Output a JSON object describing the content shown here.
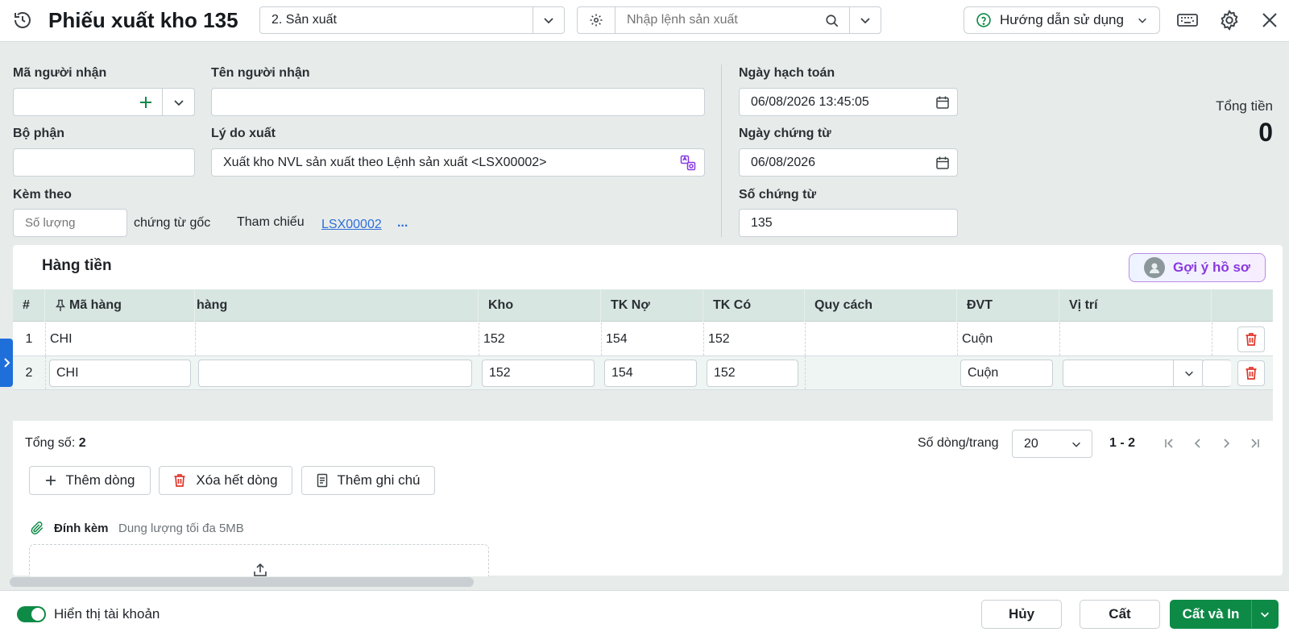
{
  "header": {
    "title": "Phiếu xuất kho 135",
    "type_select_value": "2. Sản xuất",
    "search_placeholder": "Nhập lệnh sản xuất",
    "help_label": "Hướng dẫn sử dụng"
  },
  "form": {
    "ma_nguoi_nhan_label": "Mã người nhận",
    "ten_nguoi_nhan_label": "Tên người nhận",
    "bo_phan_label": "Bộ phận",
    "ly_do_xuat_label": "Lý do xuất",
    "ly_do_xuat_value": "Xuất kho NVL sản xuất theo Lệnh sản xuất <LSX00002>",
    "kem_theo_label": "Kèm theo",
    "so_luong_placeholder": "Số lượng",
    "chung_tu_goc_label": "chứng từ gốc",
    "tham_chieu_label": "Tham chiếu",
    "tham_chieu_link": "LSX00002",
    "tham_chieu_more": "...",
    "ngay_hach_toan_label": "Ngày hạch toán",
    "ngay_hach_toan_value": "06/08/2026 13:45:05",
    "ngay_chung_tu_label": "Ngày chứng từ",
    "ngay_chung_tu_value": "06/08/2026",
    "so_chung_tu_label": "Số chứng từ",
    "so_chung_tu_value": "135",
    "tong_tien_label": "Tổng tiền",
    "tong_tien_value": "0"
  },
  "grid": {
    "section_title": "Hàng tiền",
    "suggest_label": "Gợi ý hồ sơ",
    "columns": [
      "#",
      "Mã hàng",
      "hàng",
      "Kho",
      "TK Nợ",
      "TK Có",
      "Quy cách",
      "ĐVT",
      "Vị trí"
    ],
    "rows": [
      {
        "num": "1",
        "ma_hang": "CHI",
        "ten_hang": "",
        "kho": "152",
        "tk_no": "154",
        "tk_co": "152",
        "quy_cach": "",
        "dvt": "Cuộn",
        "vi_tri": ""
      },
      {
        "num": "2",
        "ma_hang": "CHI",
        "ten_hang": "",
        "kho": "152",
        "tk_no": "154",
        "tk_co": "152",
        "quy_cach": "",
        "dvt": "Cuộn",
        "vi_tri": ""
      }
    ],
    "total_label": "Tổng số:",
    "total_value": "2",
    "page_size_label": "Số dòng/trang",
    "page_size_value": "20",
    "page_range": "1 - 2"
  },
  "actions": {
    "add_row": "Thêm dòng",
    "delete_all": "Xóa hết dòng",
    "add_note": "Thêm ghi chú"
  },
  "attachment": {
    "label": "Đính kèm",
    "hint": "Dung lượng tối đa 5MB"
  },
  "footer": {
    "toggle_label": "Hiển thị tài khoản",
    "cancel": "Hủy",
    "save": "Cất",
    "save_print": "Cất và In"
  },
  "colors": {
    "brand_green": "#0e8a47",
    "link_blue": "#2f6fd6",
    "delete_red": "#e0372c",
    "suggest_purple": "#8a39e0"
  }
}
